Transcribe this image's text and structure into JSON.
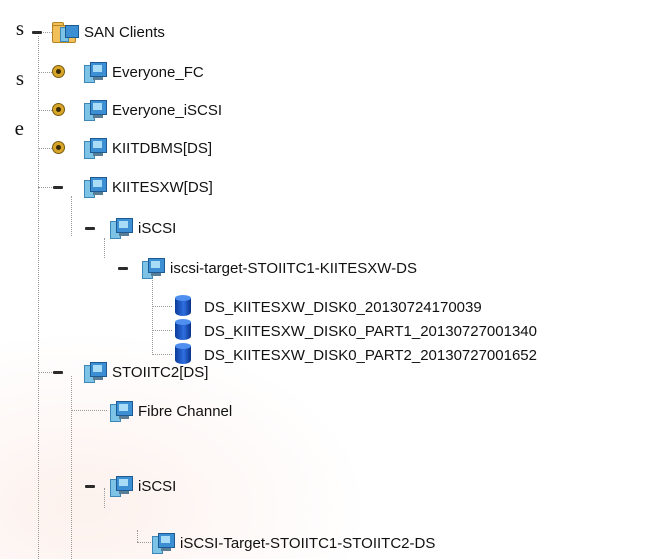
{
  "doc_fragments": [
    "s",
    "s",
    "e"
  ],
  "tree": {
    "root": {
      "label": "SAN Clients",
      "icon": "san-clients-folder-icon",
      "expanded": true
    },
    "clients": [
      {
        "label": "Everyone_FC",
        "state": "collapsed"
      },
      {
        "label": "Everyone_iSCSI",
        "state": "collapsed"
      },
      {
        "label": "KIITDBMS[DS]",
        "state": "collapsed"
      },
      {
        "label": "KIITESXW[DS]",
        "state": "expanded"
      },
      {
        "label": "STOIITC2[DS]",
        "state": "expanded"
      }
    ],
    "kiitesxw": {
      "protocol": {
        "label": "iSCSI",
        "state": "expanded"
      },
      "target": {
        "label": "iscsi-target-STOIITC1-KIITESXW-DS",
        "state": "expanded"
      },
      "disks": [
        {
          "label": "DS_KIITESXW_DISK0_20130724170039"
        },
        {
          "label": "DS_KIITESXW_DISK0_PART1_20130727001340"
        },
        {
          "label": "DS_KIITESXW_DISK0_PART2_20130727001652"
        }
      ]
    },
    "stoiitc2": {
      "fibre": {
        "label": "Fibre Channel"
      },
      "protocol": {
        "label": "iSCSI",
        "state": "expanded"
      },
      "target": {
        "label": "iSCSI-Target-STOIITC1-STOIITC2-DS"
      }
    }
  },
  "colors": {
    "toggle_plus": "#d8a628",
    "disk": "#1f5fd0",
    "client_icon": "#3d8fd4",
    "folder": "#f1c05a"
  }
}
